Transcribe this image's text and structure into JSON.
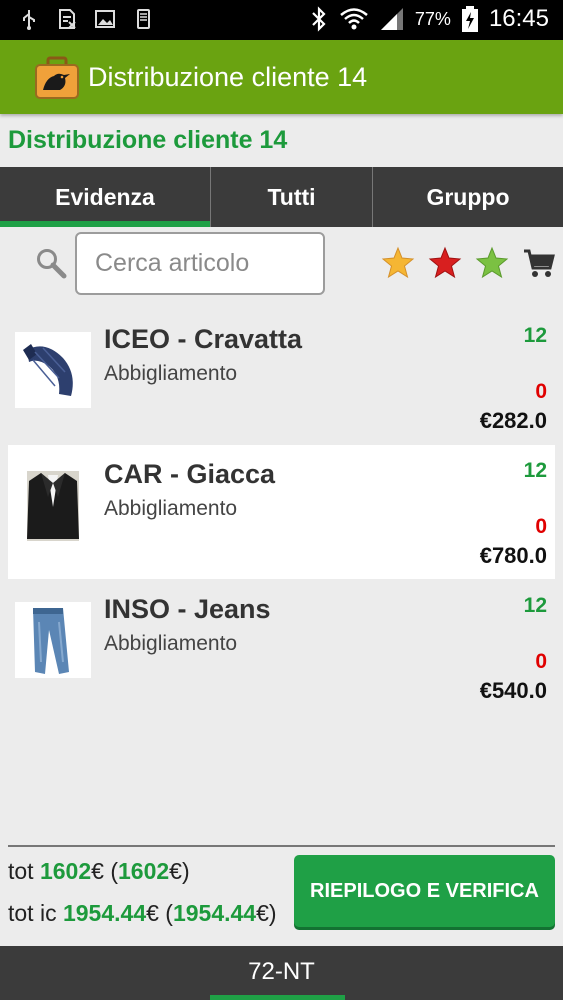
{
  "status_bar": {
    "icons": [
      "usb-icon",
      "sim-icon",
      "image-icon",
      "phone-icon",
      "bluetooth-icon",
      "wifi-icon",
      "signal-icon",
      "battery-charging-icon"
    ],
    "battery": "77%",
    "time": "16:45"
  },
  "action_bar": {
    "title": "Distribuzione cliente 14",
    "icon": "pigeon-briefcase-icon"
  },
  "subtitle": "Distribuzione cliente 14",
  "tabs": [
    {
      "label": "Evidenza",
      "active": true
    },
    {
      "label": "Tutti",
      "active": false
    },
    {
      "label": "Gruppo",
      "active": false
    }
  ],
  "search": {
    "placeholder": "Cerca articolo",
    "value": ""
  },
  "filters": {
    "star_colors": [
      "#f5b633",
      "#d81f1f",
      "#7bc142"
    ],
    "cart_icon": "shopping-cart-icon"
  },
  "items": [
    {
      "name": "ICEO - Cravatta",
      "category": "Abbigliamento",
      "qty": "12",
      "missing": "0",
      "price": "€282.0",
      "image": "tie-image"
    },
    {
      "name": "CAR - Giacca",
      "category": "Abbigliamento",
      "qty": "12",
      "missing": "0",
      "price": "€780.0",
      "image": "jacket-image"
    },
    {
      "name": "INSO - Jeans",
      "category": "Abbigliamento",
      "qty": "12",
      "missing": "0",
      "price": "€540.0",
      "image": "jeans-image"
    }
  ],
  "totals": {
    "tot_label": "tot",
    "tot_value": "1602",
    "tot_paren": "1602",
    "tot_ic_label": "tot ic",
    "tot_ic_value": "1954.44",
    "tot_ic_paren": "1954.44"
  },
  "summary_button": "RIEPILOGO E VERIFICA",
  "bottom_bar": "72-NT",
  "colors": {
    "accent_green": "#1fa046",
    "actionbar_green": "#6aa311",
    "tab_bg": "#3b3b3b",
    "qty_green": "#1d9a3c",
    "missing_red": "#e00000"
  }
}
